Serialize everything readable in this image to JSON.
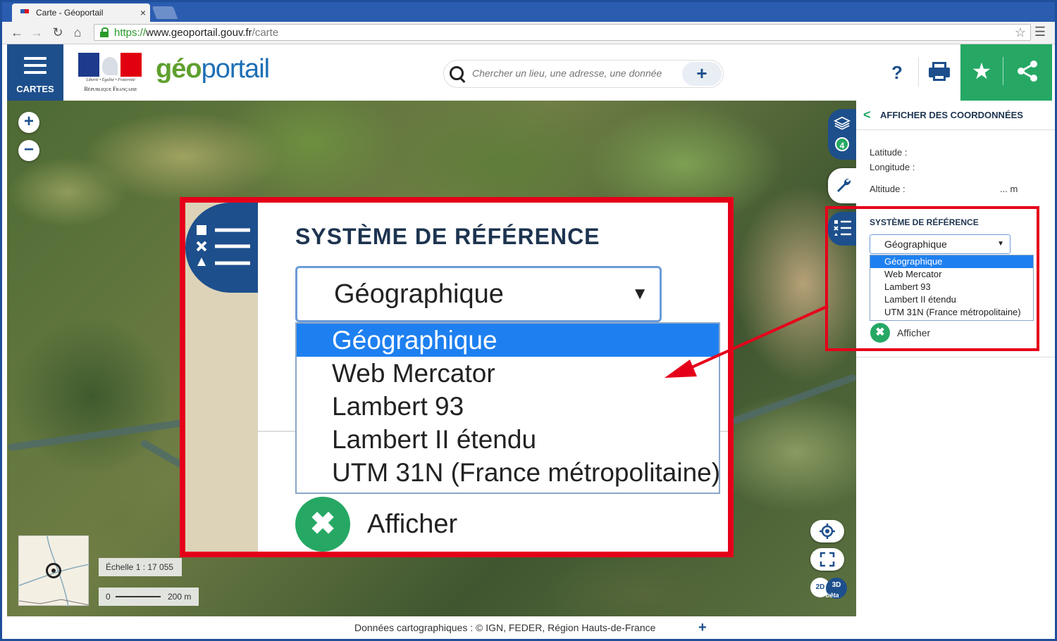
{
  "browser": {
    "tab_title": "Carte - Géoportail",
    "tab_close": "×",
    "url_scheme": "https://",
    "url_host": "www.geoportail.gouv.fr",
    "url_path": "/carte"
  },
  "header": {
    "menu_label": "CARTES",
    "rf_motto": "Liberté • Égalité • Fraternité",
    "rf_name": "République Française",
    "logo_part1": "g",
    "logo_part2": "éo",
    "logo_part3": "portail",
    "search_placeholder": "Chercher un lieu, une adresse, une donnée",
    "add_label": "+",
    "help_label": "?"
  },
  "map": {
    "zoom_in": "+",
    "zoom_out": "−",
    "scale_text": "Échelle 1 : 17 055",
    "scale_start": "0",
    "scale_end": "200 m",
    "btn_2d": "2D",
    "btn_3d": "3D",
    "btn_beta": "bêta"
  },
  "sidebar": {
    "layers_count": "4"
  },
  "panel": {
    "back": "<",
    "title": "AFFICHER DES COORDONNÉES",
    "latitude_label": "Latitude :",
    "longitude_label": "Longitude :",
    "altitude_label": "Altitude :",
    "altitude_value": "... m",
    "ref_title": "SYSTÈME DE RÉFÉRENCE",
    "ref_selected": "Géographique",
    "ref_options": [
      "Géographique",
      "Web Mercator",
      "Lambert 93",
      "Lambert II étendu",
      "UTM 31N (France métropolitaine)"
    ],
    "afficher_label": "Afficher"
  },
  "zoom": {
    "title": "SYSTÈME DE RÉFÉRENCE",
    "selected": "Géographique",
    "options": [
      "Géographique",
      "Web Mercator",
      "Lambert 93",
      "Lambert II étendu",
      "UTM 31N (France métropolitaine)"
    ],
    "afficher_label": "Afficher"
  },
  "footer": {
    "credits": "Données cartographiques : ©  IGN,  FEDER,  Région Hauts-de-France",
    "more": "+"
  },
  "colors": {
    "brand_blue": "#1d4f8c",
    "brand_green": "#26a864",
    "highlight_red": "#e5001a",
    "selection_blue": "#1e80f0"
  }
}
